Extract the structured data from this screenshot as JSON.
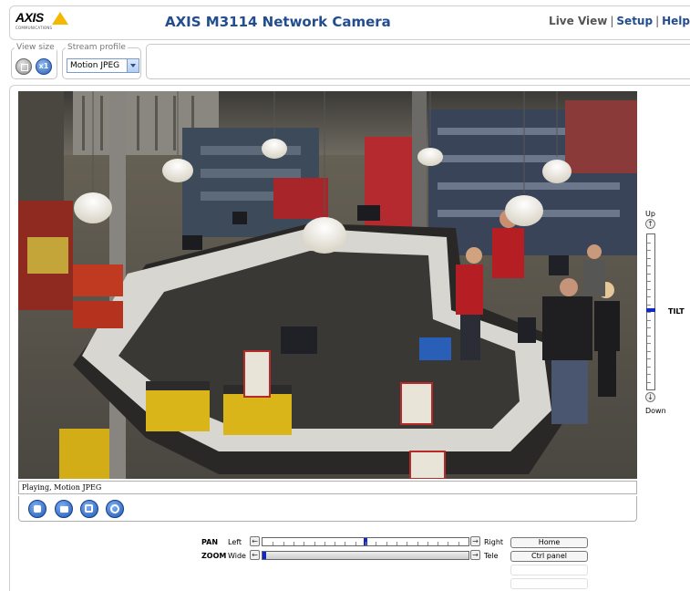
{
  "header": {
    "logo_text": "AXIS",
    "logo_sub": "COMMUNICATIONS",
    "title": "AXIS M3114 Network Camera",
    "nav": {
      "live_view": "Live View",
      "setup": "Setup",
      "help": "Help",
      "separator": "|"
    }
  },
  "toolbar": {
    "view_size_legend": "View size",
    "view_size_full_icon": "fullscreen-icon",
    "view_size_x1": "x1",
    "stream_profile_legend": "Stream profile",
    "stream_profile_value": "Motion JPEG"
  },
  "video": {
    "status": "Playing, Motion JPEG"
  },
  "controls": {
    "buttons": [
      "stop-icon",
      "snapshot-icon",
      "record-icon",
      "ptz-icon"
    ]
  },
  "tilt": {
    "up": "Up",
    "down": "Down",
    "label": "TILT",
    "position": 0.49
  },
  "pan": {
    "label": "PAN",
    "left": "Left",
    "right": "Right",
    "position": 0.5
  },
  "zoom": {
    "label": "ZOOM",
    "wide": "Wide",
    "tele": "Tele",
    "position": 0.0
  },
  "buttons": {
    "home": "Home",
    "ctrl_panel": "Ctrl panel"
  },
  "colors": {
    "title_blue": "#224d8f",
    "slider_thumb": "#1028c8",
    "logo_yellow": "#f5b800"
  }
}
